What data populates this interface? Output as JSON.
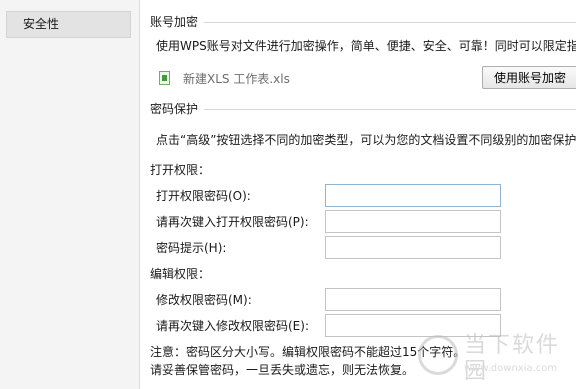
{
  "sidebar": {
    "items": [
      {
        "label": "安全性"
      }
    ]
  },
  "encrypt": {
    "title": "账号加密",
    "description": "使用WPS账号对文件进行加密操作，简单、便捷、安全、可靠！同时可以限定指",
    "file_name": "新建XLS 工作表.xls",
    "button_label": "使用账号加密"
  },
  "password": {
    "title": "密码保护",
    "description": "点击“高级”按钮选择不同的加密类型，可以为您的文档设置不同级别的加密保护",
    "open": {
      "title": "打开权限：",
      "password_label": "打开权限密码(O):",
      "confirm_label": "请再次键入打开权限密码(P):",
      "hint_label": "密码提示(H):"
    },
    "edit": {
      "title": "编辑权限：",
      "password_label": "修改权限密码(M):",
      "confirm_label": "请再次键入修改权限密码(E):"
    },
    "note1": "注意：密码区分大小写。编辑权限密码不能超过15个字符。",
    "note2": "请妥善保管密码，一旦丢失或遗忘，则无法恢复。"
  },
  "watermark": {
    "title": "当下软件园",
    "url": "www.downxia.com"
  },
  "colors": {
    "focus_border": "#8fb4d6",
    "file_icon": "#3f9a3f"
  }
}
